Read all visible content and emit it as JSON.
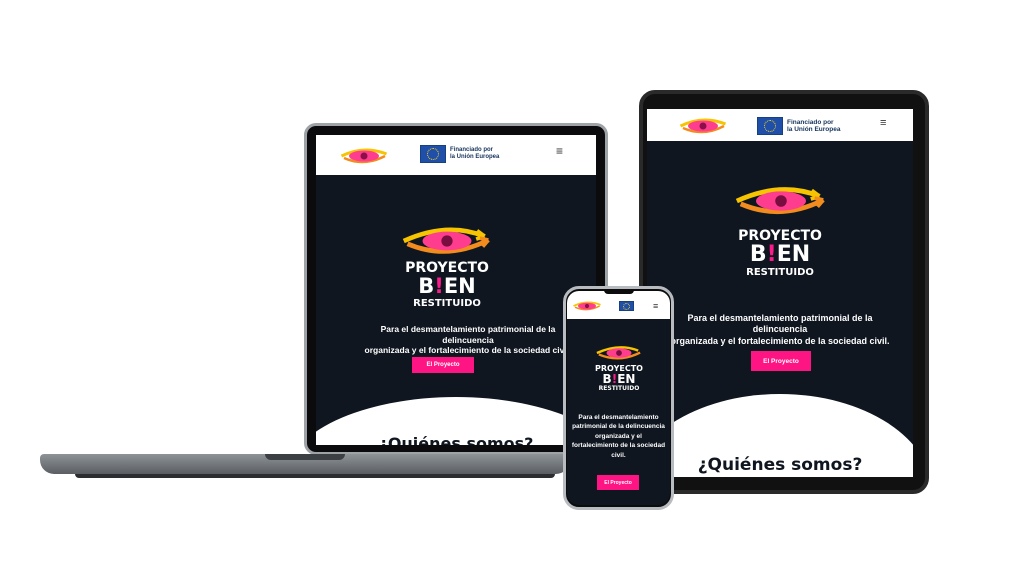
{
  "site": {
    "eu_funding_line1": "Financiado por",
    "eu_funding_line2": "la Unión Europea",
    "menu_glyph": "≡",
    "brand_line1": "PROYECTO",
    "brand_bien_b": "B",
    "brand_bien_i": "!",
    "brand_bien_rest": "EN",
    "brand_line3": "RESTITUIDO",
    "tagline": "Para el desmantelamiento patrimonial de la delincuencia organizada y el fortalecimiento de la sociedad civil.",
    "tagline_laptop_1": "Para el desmantelamiento patrimonial de la",
    "tagline_laptop_2": "delincuencia",
    "tagline_laptop_3": "organizada y el fortalecimiento de la sociedad civil.",
    "tagline_phone": "Para el desmantelamiento patrimonial de la delincuencia organizada y el fortalecimiento de la sociedad civil.",
    "cta_label": "El Proyecto",
    "about_heading": "¿Quiénes somos?"
  },
  "colors": {
    "background": "#0f1620",
    "accent_pink": "#ff1483",
    "eye_yellow": "#f6c400",
    "eye_orange": "#f28c1e",
    "eu_blue": "#1f4fa8"
  },
  "icons": {
    "menu": "hamburger-menu-icon",
    "eu": "eu-flag-icon",
    "logo": "eye-logo-icon"
  }
}
